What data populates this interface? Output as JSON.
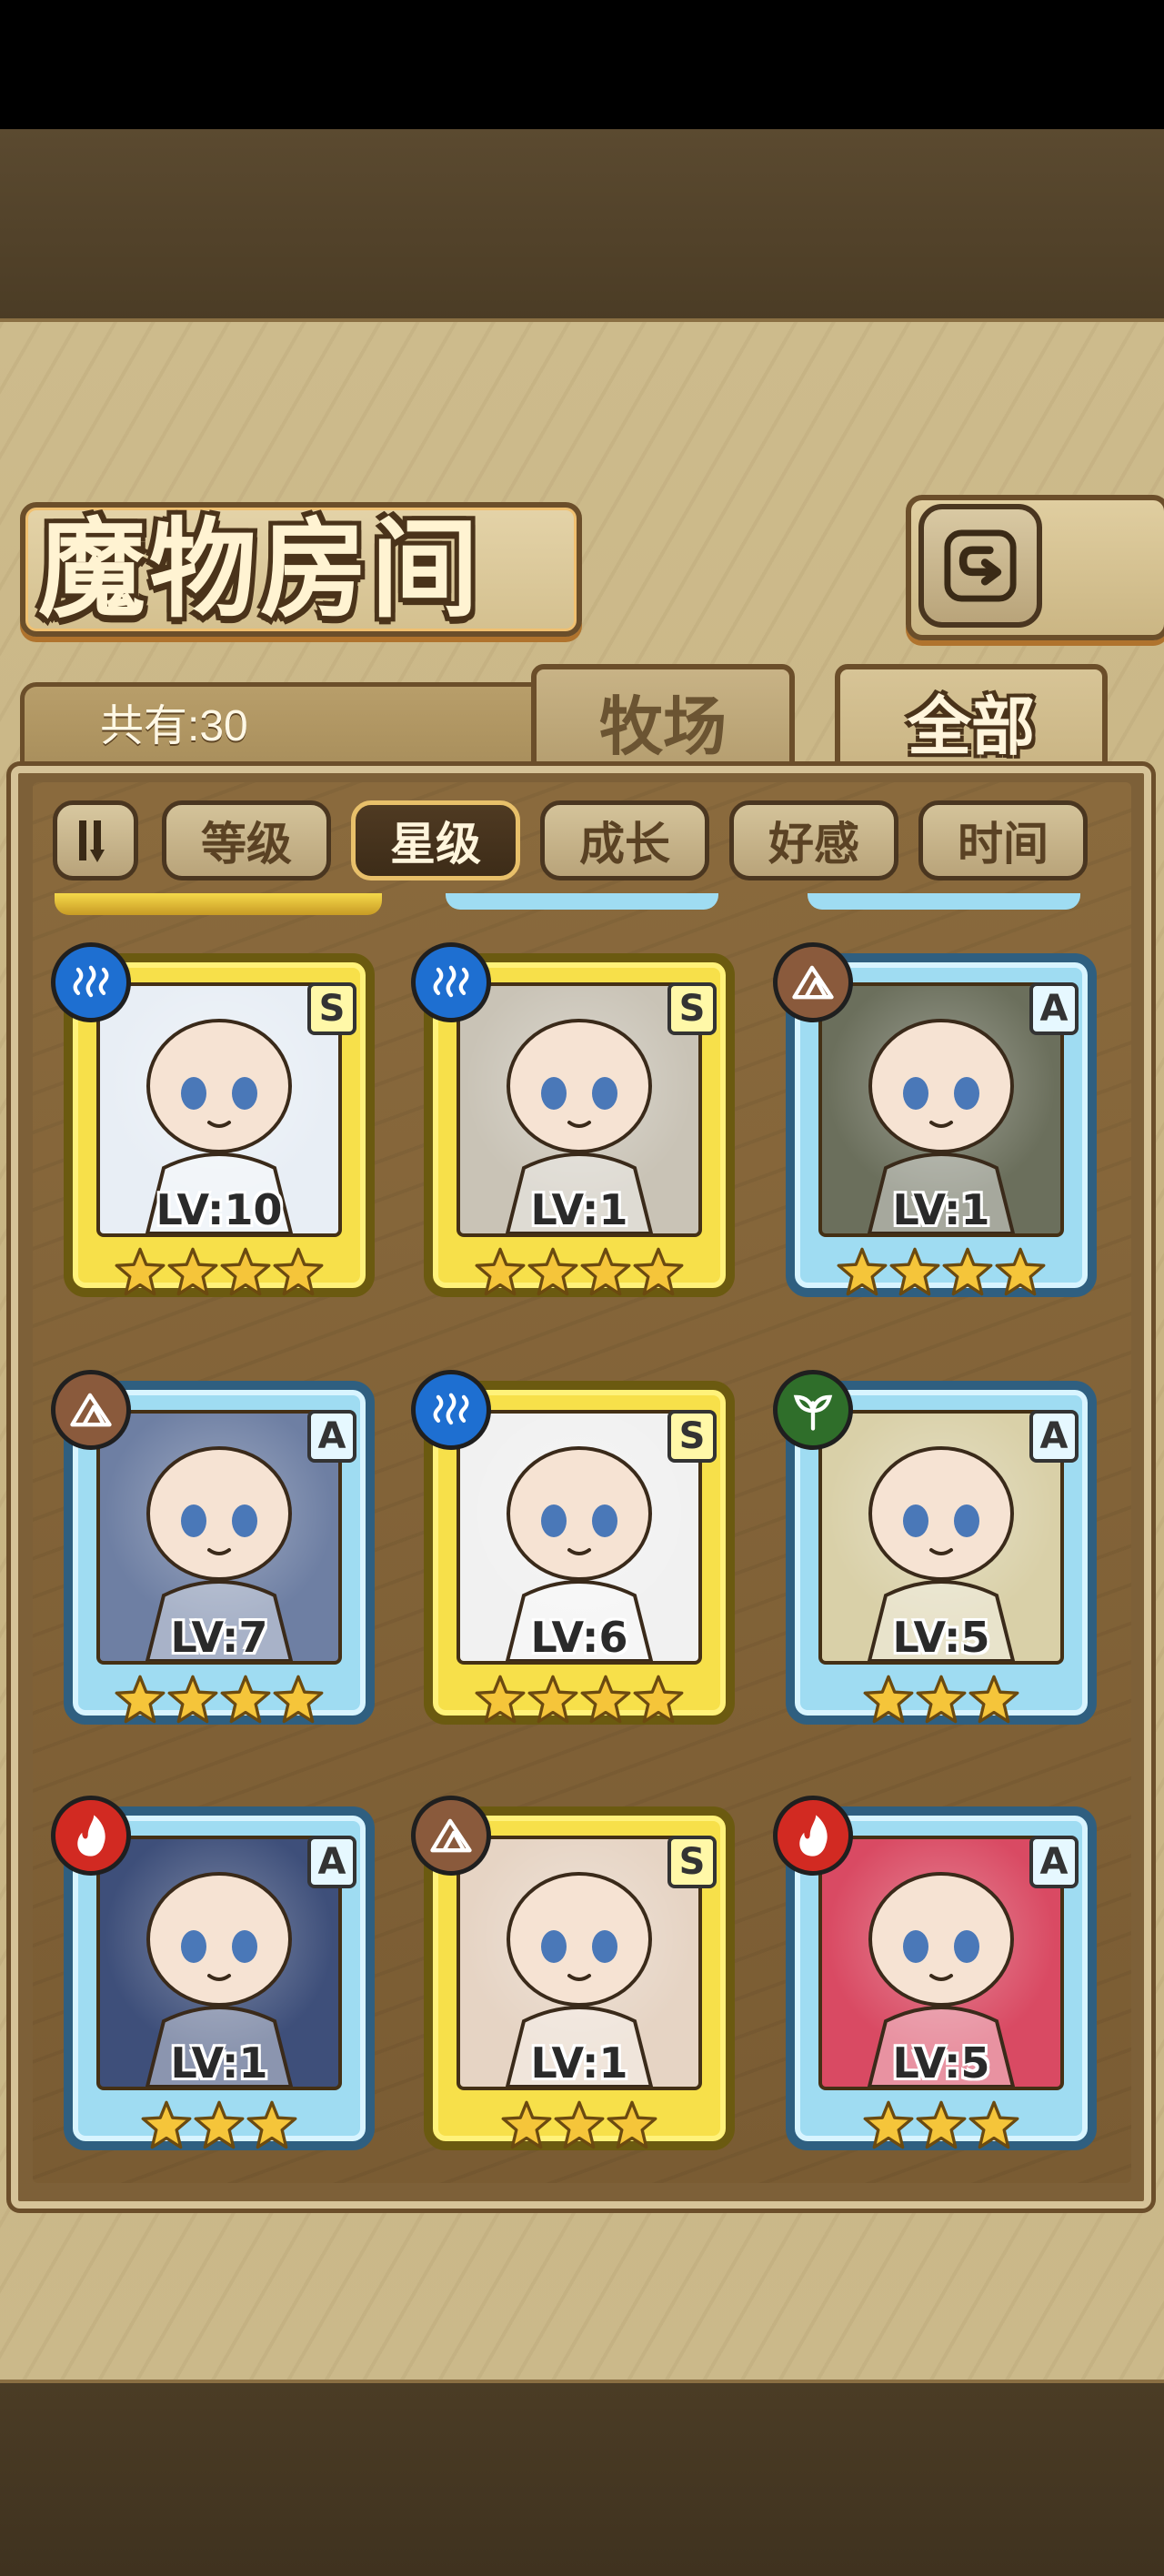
{
  "header": {
    "title": "魔物房间",
    "back_icon": "return-arrow-icon"
  },
  "summary": {
    "count_label": "共有:30"
  },
  "tabs": [
    {
      "label": "牧场",
      "active": false
    },
    {
      "label": "全部",
      "active": true
    }
  ],
  "sort": {
    "toggle_icon": "sort-order-toggle-icon",
    "buttons": [
      {
        "label": "等级",
        "active": false
      },
      {
        "label": "星级",
        "active": true
      },
      {
        "label": "成长",
        "active": false
      },
      {
        "label": "好感",
        "active": false
      },
      {
        "label": "时间",
        "active": false
      }
    ]
  },
  "monsters": [
    {
      "level": "LV:10",
      "stars": 4,
      "element": "water",
      "rank": "S",
      "frame": "gold"
    },
    {
      "level": "LV:1",
      "stars": 4,
      "element": "water",
      "rank": "S",
      "frame": "gold"
    },
    {
      "level": "LV:1",
      "stars": 4,
      "element": "earth",
      "rank": "A",
      "frame": "blue"
    },
    {
      "level": "LV:7",
      "stars": 4,
      "element": "earth",
      "rank": "A",
      "frame": "blue"
    },
    {
      "level": "LV:6",
      "stars": 4,
      "element": "water",
      "rank": "S",
      "frame": "gold"
    },
    {
      "level": "LV:5",
      "stars": 3,
      "element": "grass",
      "rank": "A",
      "frame": "blue"
    },
    {
      "level": "LV:1",
      "stars": 3,
      "element": "fire",
      "rank": "A",
      "frame": "blue"
    },
    {
      "level": "LV:1",
      "stars": 3,
      "element": "earth",
      "rank": "S",
      "frame": "gold"
    },
    {
      "level": "LV:5",
      "stars": 3,
      "element": "fire",
      "rank": "A",
      "frame": "blue"
    }
  ],
  "colors": {
    "water": "#1e6fd1",
    "earth": "#8a5a3c",
    "grass": "#2f6e2a",
    "fire": "#d22a22",
    "star": "#f5c53a",
    "portrait_bgs": [
      "#e8eef5",
      "#c9c3b6",
      "#6b6f5c",
      "#6e7fa3",
      "#f1f1f1",
      "#d9d0a8",
      "#3e4f7a",
      "#e6d4c4",
      "#d94a63"
    ]
  }
}
